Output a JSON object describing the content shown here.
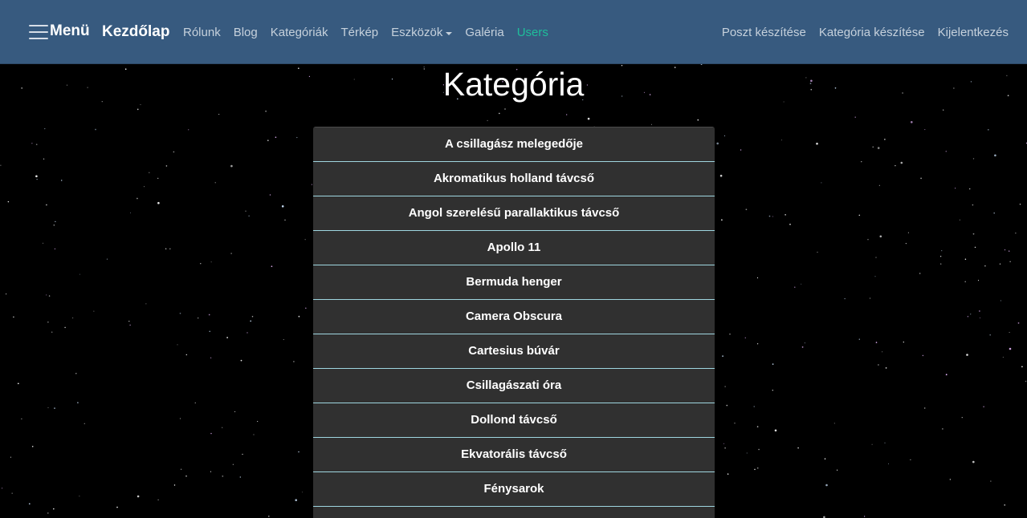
{
  "navbar": {
    "menu_label": "Menü",
    "brand": "Kezdőlap",
    "links": [
      {
        "label": "Rólunk"
      },
      {
        "label": "Blog"
      },
      {
        "label": "Kategóriák"
      },
      {
        "label": "Térkép"
      },
      {
        "label": "Eszközök"
      },
      {
        "label": "Galéria"
      },
      {
        "label": "Users"
      }
    ],
    "right_links": [
      {
        "label": "Poszt készítése"
      },
      {
        "label": "Kategória készítése"
      },
      {
        "label": "Kijelentkezés"
      }
    ]
  },
  "page": {
    "title": "Kategória"
  },
  "categories": [
    "A csillagász melegedője",
    "Akromatikus holland távcső",
    "Angol szerelésű parallaktikus távcső",
    "Apollo 11",
    "Bermuda henger",
    "Camera Obscura",
    "Cartesius búvár",
    "Csillagászati óra",
    "Dollond távcső",
    "Ekvatorális távcső",
    "Fénysarok",
    ""
  ],
  "colors": {
    "navbar_bg": "#375a7f",
    "active_link": "#1ebe9b",
    "list_item_bg": "#303030",
    "list_divider": "#9fd6e0",
    "background": "#000000"
  }
}
